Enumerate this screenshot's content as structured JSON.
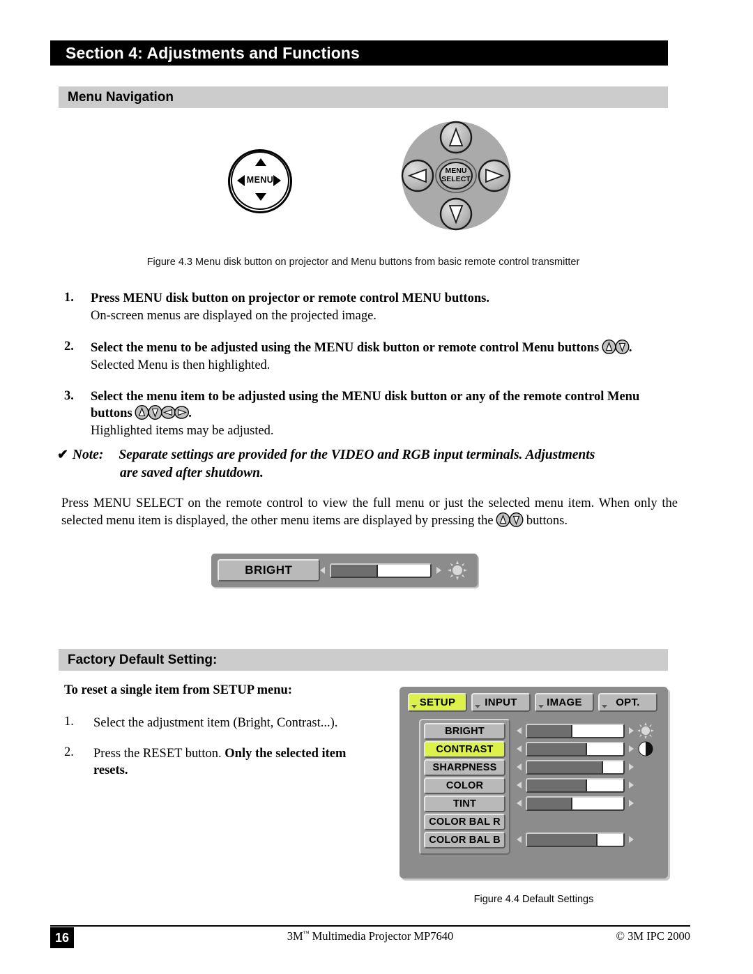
{
  "section": {
    "title": "Section 4: Adjustments and Functions"
  },
  "subsections": {
    "menu_navigation": "Menu Navigation",
    "factory_default": "Factory Default Setting:"
  },
  "figure_4_3": {
    "caption": "Figure 4.3 Menu disk button on projector and Menu buttons from basic remote control transmitter",
    "projector_disk": {
      "label": "MENU",
      "icons": [
        "triangle-up-icon",
        "triangle-down-icon",
        "triangle-left-icon",
        "triangle-right-icon"
      ]
    },
    "remote_disk": {
      "center_line1": "MENU",
      "center_line2": "SELECT",
      "icons": [
        "triangle-up-icon",
        "triangle-down-icon",
        "triangle-left-icon",
        "triangle-right-icon"
      ]
    }
  },
  "steps": [
    {
      "num": "1.",
      "head": "Press MENU disk button on projector or remote control MENU buttons.",
      "sub": "On-screen menus are displayed on the projected image.",
      "glyphs": []
    },
    {
      "num": "2.",
      "head_before": "Select the menu to be adjusted using the MENU disk button or remote control Menu buttons ",
      "head_after": ".",
      "sub": "Selected Menu is then highlighted.",
      "glyphs": [
        "up-button-icon",
        "down-button-icon"
      ]
    },
    {
      "num": "3.",
      "head_before": "Select the menu item to be adjusted using the MENU disk button or any of the remote control Menu buttons ",
      "head_after": ".",
      "sub": "Highlighted items may be adjusted.",
      "glyphs": [
        "up-button-icon",
        "down-button-icon",
        "left-button-icon",
        "right-button-icon"
      ]
    }
  ],
  "note": {
    "check": "✔",
    "label": "Note:",
    "line1": "Separate settings are provided for the VIDEO and RGB input terminals.  Adjustments",
    "line2": "are saved after shutdown."
  },
  "paragraph": {
    "part1": "Press MENU SELECT on the remote control to view the full menu or just the selected menu item. When only the selected menu item is displayed, the other menu items are displayed by pressing the ",
    "part2": " buttons.",
    "glyphs": [
      "up-button-icon",
      "down-button-icon"
    ]
  },
  "bright_osd": {
    "label": "BRIGHT",
    "fill_percent": 47,
    "left_arrow": "arrow-left-icon",
    "right_arrow": "arrow-right-icon",
    "icon": "brightness-sun-icon"
  },
  "factory_default": {
    "intro": "To reset a single item from SETUP menu:",
    "steps": [
      {
        "num": "1.",
        "text": "Select the adjustment item (Bright, Contrast...).",
        "bold": ""
      },
      {
        "num": "2.",
        "text": "Press the RESET button. ",
        "bold": "Only the selected item resets."
      }
    ]
  },
  "osd_menu": {
    "tabs": [
      {
        "label": "SETUP",
        "active": true
      },
      {
        "label": "INPUT",
        "active": false
      },
      {
        "label": "IMAGE",
        "active": false
      },
      {
        "label": "OPT.",
        "active": false
      }
    ],
    "items": [
      {
        "label": "BRIGHT",
        "selected": false,
        "fill_percent": 47,
        "has_slider": true,
        "icon": "brightness-sun-icon"
      },
      {
        "label": "CONTRAST",
        "selected": true,
        "fill_percent": 62,
        "has_slider": true,
        "icon": "contrast-half-circle-icon"
      },
      {
        "label": "SHARPNESS",
        "selected": false,
        "fill_percent": 79,
        "has_slider": true,
        "icon": ""
      },
      {
        "label": "COLOR",
        "selected": false,
        "fill_percent": 62,
        "has_slider": true,
        "icon": ""
      },
      {
        "label": "TINT",
        "selected": false,
        "fill_percent": 47,
        "has_slider": true,
        "icon": ""
      },
      {
        "label": "COLOR BAL R",
        "selected": false,
        "fill_percent": 0,
        "has_slider": false,
        "icon": ""
      },
      {
        "label": "COLOR BAL B",
        "selected": false,
        "fill_percent": 73,
        "has_slider": true,
        "icon": ""
      }
    ],
    "highlight_color": "#dcf24a",
    "panel_color": "#8c8c8c",
    "caption": "Figure 4.4 Default Settings"
  },
  "footer": {
    "page_number": "16",
    "center": "3M",
    "center_sup": "™",
    "center_rest": " Multimedia Projector MP7640",
    "right": "© 3M IPC 2000"
  }
}
